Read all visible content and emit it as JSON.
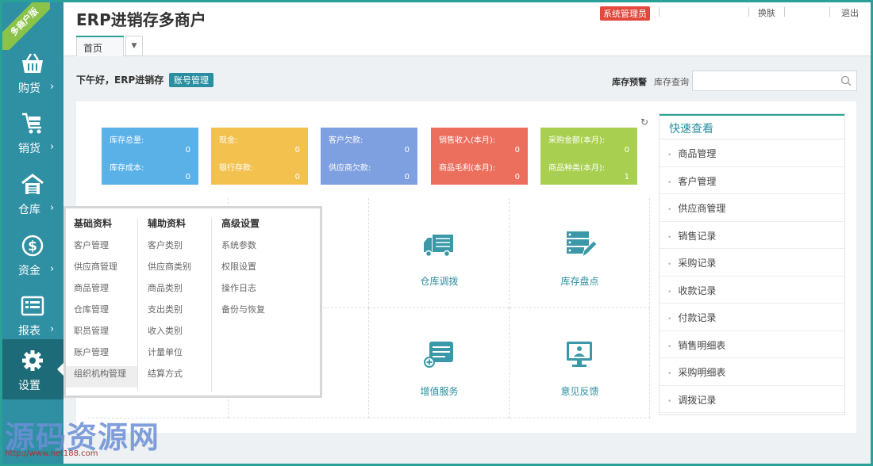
{
  "ribbon_text": "多商户版",
  "sidebar": {
    "items": [
      {
        "label": "购货",
        "icon": "basket-icon"
      },
      {
        "label": "销货",
        "icon": "cart-icon"
      },
      {
        "label": "仓库",
        "icon": "warehouse-icon"
      },
      {
        "label": "资金",
        "icon": "dollar-icon"
      },
      {
        "label": "报表",
        "icon": "report-icon"
      },
      {
        "label": "设置",
        "icon": "gear-icon"
      }
    ],
    "chevron": "›"
  },
  "header": {
    "title": "ERP进销存多商户",
    "role_badge": "系统管理员",
    "switch_label": "换肤",
    "logout_label": "退出",
    "tab_home": "首页",
    "tab_dropdown": "▼"
  },
  "greeting": {
    "text": "下午好，ERP进销存",
    "account_button": "账号管理"
  },
  "search": {
    "stock_warning": "库存预警",
    "stock_query": "库存查询",
    "placeholder": ""
  },
  "refresh_icon": "↻",
  "stats": [
    {
      "label1": "库存总量:",
      "value1": "0",
      "label2": "库存成本:",
      "value2": "0",
      "color": "#5ab1e8"
    },
    {
      "label1": "现金:",
      "value1": "0",
      "label2": "银行存款:",
      "value2": "0",
      "color": "#f2c14e"
    },
    {
      "label1": "客户欠款:",
      "value1": "0",
      "label2": "供应商欠款:",
      "value2": "0",
      "color": "#7e9fe0"
    },
    {
      "label1": "销售收入(本月):",
      "value1": "0",
      "label2": "商品毛利(本月):",
      "value2": "0",
      "color": "#ec6f5e"
    },
    {
      "label1": "采购金额(本月):",
      "value1": "0",
      "label2": "商品种类(本月):",
      "value2": "1",
      "color": "#a8cf4f"
    }
  ],
  "shortcuts": [
    {
      "label": "仓库调拨",
      "icon": "truck-icon"
    },
    {
      "label": "库存盘点",
      "icon": "inventory-check-icon"
    },
    {
      "label": "增值服务",
      "icon": "value-added-icon"
    },
    {
      "label": "意见反馈",
      "icon": "feedback-icon"
    }
  ],
  "quick_view": {
    "title": "快速查看",
    "items": [
      "商品管理",
      "客户管理",
      "供应商管理",
      "销售记录",
      "采购记录",
      "收款记录",
      "付款记录",
      "销售明细表",
      "采购明细表",
      "调拨记录"
    ]
  },
  "flyout": {
    "columns": [
      {
        "title": "基础资料",
        "items": [
          "客户管理",
          "供应商管理",
          "商品管理",
          "仓库管理",
          "职员管理",
          "账户管理",
          "组织机构管理"
        ]
      },
      {
        "title": "辅助资料",
        "items": [
          "客户类别",
          "供应商类别",
          "商品类别",
          "支出类别",
          "收入类别",
          "计量单位",
          "结算方式"
        ]
      },
      {
        "title": "高级设置",
        "items": [
          "系统参数",
          "权限设置",
          "操作日志",
          "备份与恢复"
        ]
      }
    ]
  },
  "watermark": {
    "text": "源码资源网",
    "url": "http://www.net188.com"
  }
}
